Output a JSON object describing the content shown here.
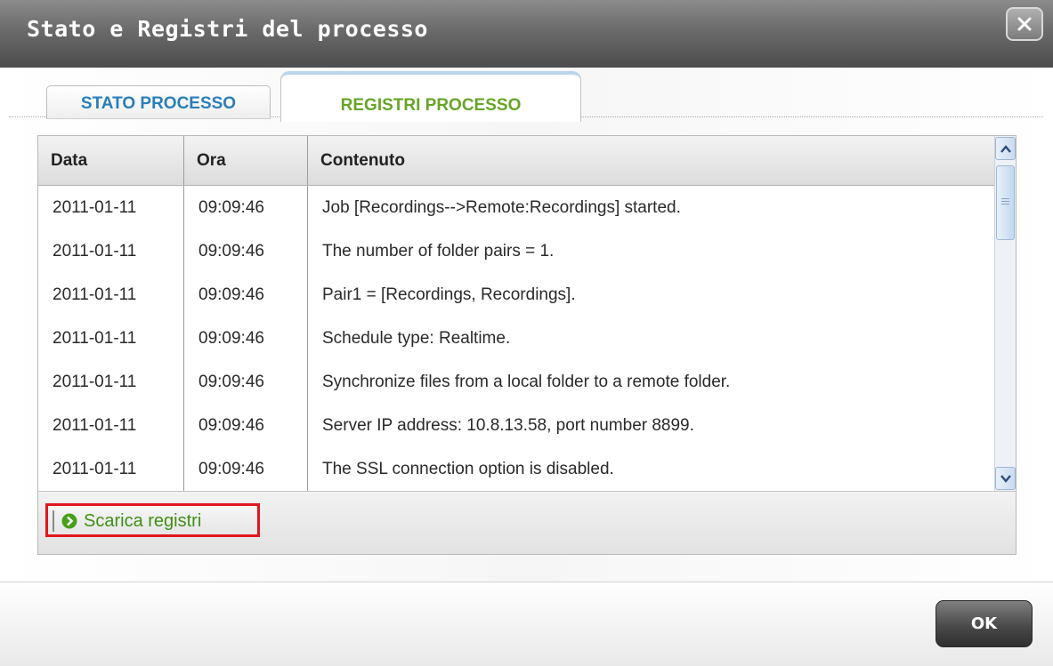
{
  "window": {
    "title": "Stato e Registri del processo"
  },
  "tabs": [
    {
      "label": "STATO PROCESSO",
      "active": false
    },
    {
      "label": "REGISTRI PROCESSO",
      "active": true
    }
  ],
  "table": {
    "columns": [
      "Data",
      "Ora",
      "Contenuto"
    ],
    "rows": [
      {
        "date": "2011-01-11",
        "time": "09:09:46",
        "content": "Job [Recordings-->Remote:Recordings] started."
      },
      {
        "date": "2011-01-11",
        "time": "09:09:46",
        "content": "The number of folder pairs = 1."
      },
      {
        "date": "2011-01-11",
        "time": "09:09:46",
        "content": "Pair1 = [Recordings, Recordings]."
      },
      {
        "date": "2011-01-11",
        "time": "09:09:46",
        "content": "Schedule type: Realtime."
      },
      {
        "date": "2011-01-11",
        "time": "09:09:46",
        "content": "Synchronize files from a local folder to a remote folder."
      },
      {
        "date": "2011-01-11",
        "time": "09:09:46",
        "content": "Server IP address: 10.8.13.58, port number 8899."
      },
      {
        "date": "2011-01-11",
        "time": "09:09:46",
        "content": "The SSL connection option is disabled."
      }
    ]
  },
  "actions": {
    "download_logs": "Scarica registri",
    "ok": "OK"
  },
  "colors": {
    "active_tab": "#67a528",
    "inactive_tab": "#2a7fb8",
    "highlight_border": "#e0161d"
  }
}
